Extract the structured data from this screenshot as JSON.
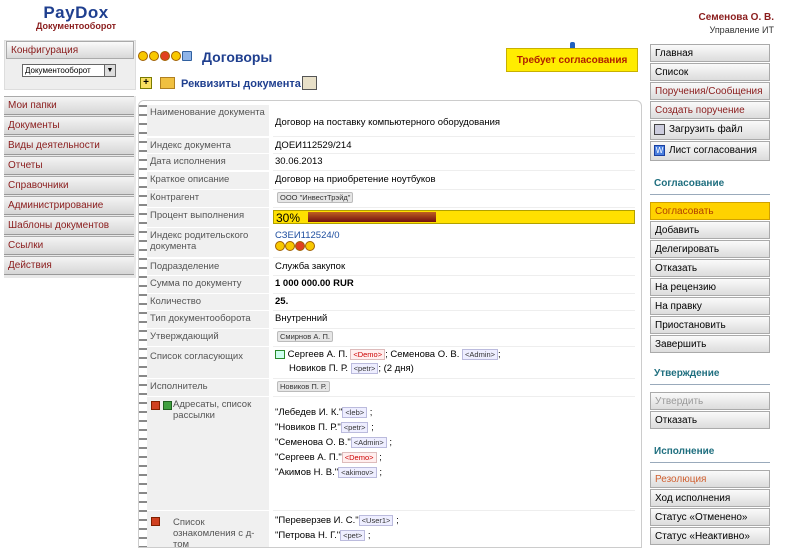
{
  "app": {
    "logo": "PayDox",
    "logo_sub": "Документооборот"
  },
  "user": {
    "name": "Семенова О. В.",
    "dept": "Управление ИТ"
  },
  "left": {
    "config": "Конфигурация",
    "select_value": "Документооборот",
    "menu": [
      "Мои папки",
      "Документы",
      "Виды деятельности",
      "Отчеты",
      "Справочники",
      "Администрирование",
      "Шаблоны документов",
      "Ссылки",
      "Действия"
    ]
  },
  "header": {
    "title": "Договоры",
    "approve_banner": "Требует согласования",
    "sub_label": "Реквизиты документа"
  },
  "fields": [
    {
      "k": "Наименование документа",
      "v": "Договор на поставку компьютерного оборудования"
    },
    {
      "k": "Индекс документа",
      "v": "ДОЕИ112529/214"
    },
    {
      "k": "Дата исполнения",
      "v": "30.06.2013"
    },
    {
      "k": "Краткое описание",
      "v": "Договор на приобретение ноутбуков"
    },
    {
      "k": "Контрагент",
      "v": "ООО \"ИнвестТрэйд\""
    },
    {
      "k": "Процент выполнения",
      "v": "30%"
    },
    {
      "k": "Индекс родительского документа",
      "v": "СЗЕИ112524/0"
    },
    {
      "k": "Подразделение",
      "v": "Служба закупок"
    },
    {
      "k": "Сумма по документу",
      "v": "1 000 000.00  RUR"
    },
    {
      "k": "Количество",
      "v": "25."
    },
    {
      "k": "Тип документооборота",
      "v": "Внутренний"
    },
    {
      "k": "Утверждающий",
      "v": "Смирнов А. П."
    },
    {
      "k": "Список согласующих",
      "v": ""
    },
    {
      "k": "Исполнитель",
      "v": "Новиков П. Р."
    },
    {
      "k": "Адресаты, список рассылки",
      "v": ""
    },
    {
      "k": "Список ознакомления с д-том",
      "v": ""
    }
  ],
  "progress": 0.3,
  "approvers": {
    "line1_a": "Сергеев А. П.",
    "line1_a_tag": "<Demo>",
    "line1_b": "; Семенова О. В.",
    "line1_b_tag": "<Admin>",
    "line1_end": ";",
    "line2_a": "Новиков П. Р.",
    "line2_a_tag": "<petr>",
    "line2_end": "; (2 дня)"
  },
  "recipients": [
    {
      "name": "\"Лебедев И. К.\"",
      "tag": "<leb>"
    },
    {
      "name": "\"Новиков П. Р.\"",
      "tag": "<petr>"
    },
    {
      "name": "\"Семенова О. В.\"",
      "tag": "<Admin>"
    },
    {
      "name": "\"Сергеев А. П.\"",
      "tag": "<Demo>"
    },
    {
      "name": "\"Акимов Н. В.\"",
      "tag": "<akimov>"
    }
  ],
  "acquaint": [
    {
      "name": "\"Переверзев И. С.\"",
      "tag": "<User1>"
    },
    {
      "name": "\"Петрова Н. Г.\"",
      "tag": "<pet>"
    }
  ],
  "right": {
    "top": [
      "Главная",
      "Список",
      "Поручения/Сообщения",
      "Создать поручение",
      "Загрузить файл",
      "Лист согласования"
    ],
    "sec1": "Согласование",
    "sec1_items": [
      "Согласовать",
      "Добавить",
      "Делегировать",
      "Отказать",
      "На рецензию",
      "На правку",
      "Приостановить",
      "Завершить"
    ],
    "sec2": "Утверждение",
    "sec2_items": [
      "Утвердить",
      "Отказать"
    ],
    "sec3": "Исполнение",
    "sec3_items": [
      "Резолюция",
      "Ход исполнения",
      "Статус «Отменено»",
      "Статус «Неактивно»"
    ]
  }
}
